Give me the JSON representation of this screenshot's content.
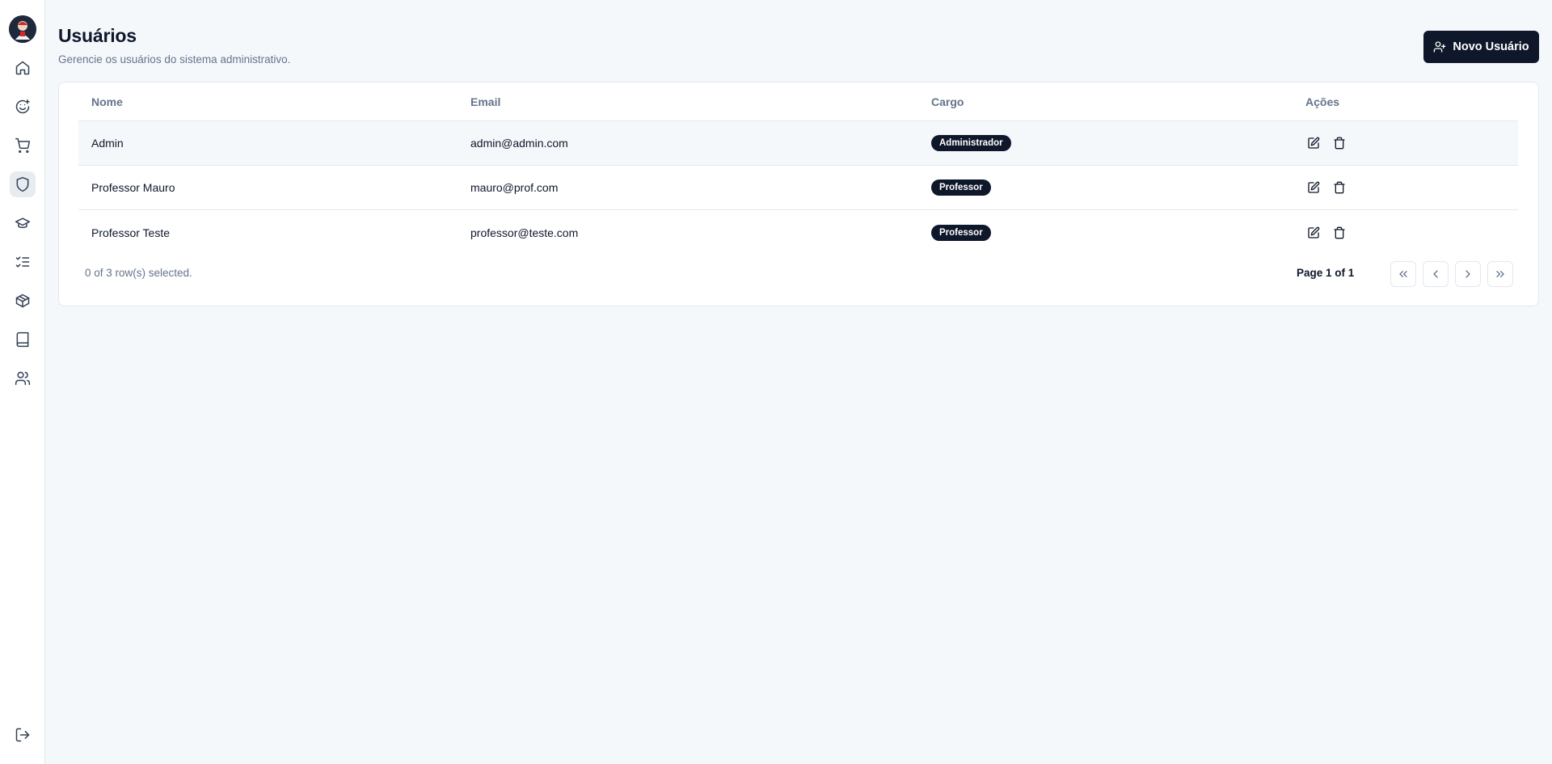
{
  "header": {
    "title": "Usuários",
    "subtitle": "Gerencie os usuários do sistema administrativo.",
    "new_user_label": "Novo Usuário"
  },
  "sidebar": {
    "items": [
      {
        "name": "home-icon",
        "active": false
      },
      {
        "name": "smile-plus-icon",
        "active": false
      },
      {
        "name": "cart-icon",
        "active": false
      },
      {
        "name": "shield-icon",
        "active": true
      },
      {
        "name": "graduation-cap-icon",
        "active": false
      },
      {
        "name": "list-checks-icon",
        "active": false
      },
      {
        "name": "package-icon",
        "active": false
      },
      {
        "name": "book-icon",
        "active": false
      },
      {
        "name": "users-icon",
        "active": false
      }
    ],
    "logout_icon": "log-out-icon"
  },
  "table": {
    "headers": {
      "nome": "Nome",
      "email": "Email",
      "cargo": "Cargo",
      "acoes": "Ações"
    },
    "rows": [
      {
        "nome": "Admin",
        "email": "admin@admin.com",
        "cargo": "Administrador"
      },
      {
        "nome": "Professor Mauro",
        "email": "mauro@prof.com",
        "cargo": "Professor"
      },
      {
        "nome": "Professor Teste",
        "email": "professor@teste.com",
        "cargo": "Professor"
      }
    ],
    "selection": "0 of 3 row(s) selected.",
    "page_info": "Page 1 of 1"
  },
  "colors": {
    "primary": "#0f172a",
    "muted": "#64748b",
    "background": "#f5f8fb",
    "border": "#e2e8f0"
  }
}
